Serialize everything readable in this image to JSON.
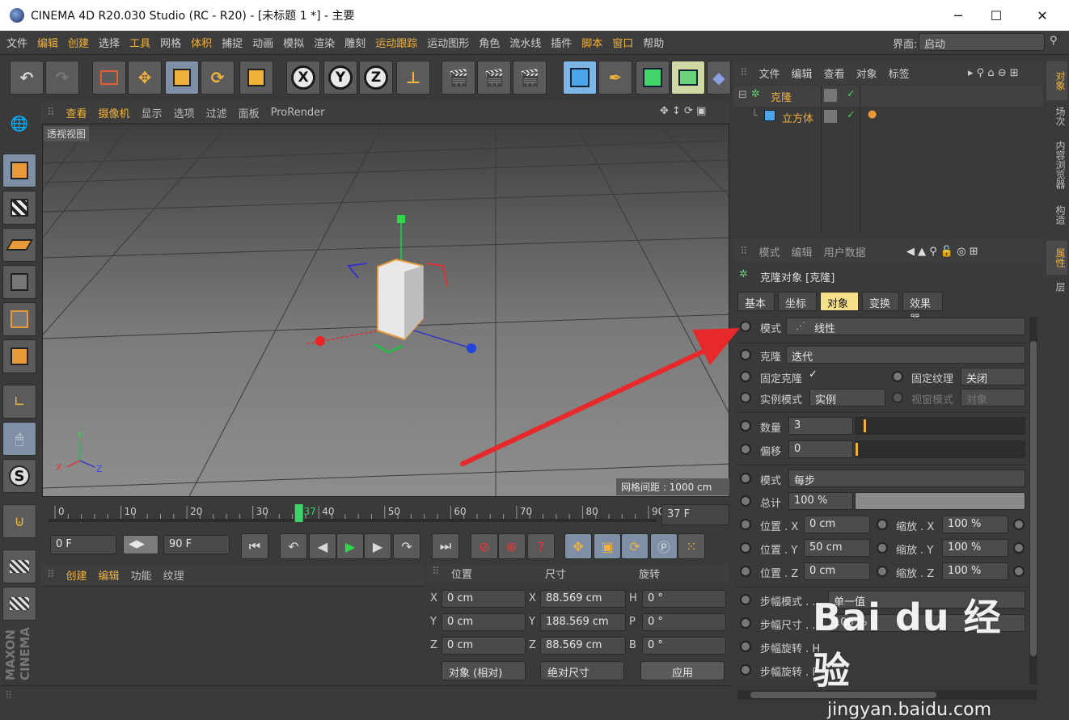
{
  "window": {
    "title": "CINEMA 4D R20.030 Studio (RC - R20) - [未标题 1 *] - 主要",
    "controls": {
      "minimize": "─",
      "maximize": "☐",
      "close": "✕"
    }
  },
  "menubar": {
    "items": [
      "文件",
      "编辑",
      "创建",
      "选择",
      "工具",
      "网格",
      "体积",
      "捕捉",
      "动画",
      "模拟",
      "渲染",
      "雕刻",
      "运动跟踪",
      "运动图形",
      "角色",
      "流水线",
      "插件",
      "脚本",
      "窗口",
      "帮助"
    ],
    "highlighted": [
      "编辑",
      "创建",
      "工具",
      "体积",
      "运动跟踪",
      "脚本",
      "窗口"
    ],
    "layout_label": "界面:",
    "layout_value": "启动"
  },
  "toolbar": {
    "axis_x": "X",
    "axis_y": "Y",
    "axis_z": "Z"
  },
  "viewport": {
    "menu": [
      "查看",
      "摄像机",
      "显示",
      "选项",
      "过滤",
      "面板",
      "ProRender"
    ],
    "highlighted": [
      "查看",
      "摄像机"
    ],
    "label": "透视视图",
    "grid_spacing": "网格间距 : 1000 cm",
    "axis_labels": {
      "x": "X",
      "y": "Y",
      "z": "Z"
    }
  },
  "timeline": {
    "ticks": [
      "0",
      "10",
      "20",
      "30",
      "40",
      "50",
      "60",
      "70",
      "80",
      "90"
    ],
    "current_frame_marker": "37",
    "frame_field": "37 F",
    "start_field": "0 F",
    "end_field": "90 F",
    "current_fraction": 0.411
  },
  "materials": {
    "menu": [
      "创建",
      "编辑",
      "功能",
      "纹理"
    ]
  },
  "coordinates": {
    "headers": [
      "位置",
      "尺寸",
      "旋转"
    ],
    "rows": [
      {
        "pos_label": "X",
        "pos": "0 cm",
        "size_label": "X",
        "size": "88.569 cm",
        "rot_label": "H",
        "rot": "0 °"
      },
      {
        "pos_label": "Y",
        "pos": "0 cm",
        "size_label": "Y",
        "size": "188.569 cm",
        "rot_label": "P",
        "rot": "0 °"
      },
      {
        "pos_label": "Z",
        "pos": "0 cm",
        "size_label": "Z",
        "size": "88.569 cm",
        "rot_label": "B",
        "rot": "0 °"
      }
    ],
    "mode_dropdown": "对象 (相对)",
    "size_dropdown": "绝对尺寸",
    "apply_button": "应用"
  },
  "object_manager": {
    "menu": [
      "文件",
      "编辑",
      "查看",
      "对象",
      "标签"
    ],
    "objects": [
      {
        "name": "克隆",
        "indent": 0
      },
      {
        "name": "立方体",
        "indent": 1
      }
    ],
    "check": "✓"
  },
  "attributes": {
    "menu": [
      "模式",
      "编辑",
      "用户数据"
    ],
    "title": "克隆对象 [克隆]",
    "tabs": [
      "基本",
      "坐标",
      "对象",
      "变换",
      "效果器"
    ],
    "selected_tab": "对象",
    "mode_label": "模式",
    "mode_value": "线性",
    "clones_label": "克隆",
    "clones_value": "迭代",
    "fix_clone_label": "固定克隆",
    "fix_clone_check": "✓",
    "fix_texture_label": "固定纹理",
    "fix_texture_value": "关闭",
    "instance_mode_label": "实例模式",
    "instance_mode_value": "实例",
    "viewport_mode_label": "视窗模式",
    "viewport_mode_value": "对象",
    "count_label": "数量",
    "count_value": "3",
    "offset_label": "偏移",
    "offset_value": "0",
    "mode2_label": "模式",
    "mode2_value": "每步",
    "amount_label": "总计",
    "amount_value": "100 %",
    "pos_x_label": "位置 . X",
    "pos_x_value": "0 cm",
    "pos_y_label": "位置 . Y",
    "pos_y_value": "50 cm",
    "pos_z_label": "位置 . Z",
    "pos_z_value": "0 cm",
    "scale_x_label": "缩放 . X",
    "scale_x_value": "100 %",
    "scale_y_label": "缩放 . Y",
    "scale_y_value": "100 %",
    "scale_z_label": "缩放 . Z",
    "scale_z_value": "100 %",
    "step_mode_label": "步幅模式 . . .",
    "step_mode_value": "单一值",
    "step_size_label": "步幅尺寸 . . .",
    "step_size_value": "100 %",
    "step_rot_h_label": "步幅旋转 . H",
    "step_rot_p_label": "步幅旋转 . P"
  },
  "side_tabs": [
    "对象",
    "场次",
    "内容浏览器",
    "构造",
    "属性",
    "层"
  ],
  "side_tabs_selected": [
    "对象",
    "属性"
  ],
  "watermark": {
    "logo": "Bai du 经验",
    "url": "jingyan.baidu.com"
  },
  "colors": {
    "accent": "#f0b23a",
    "arrow": "#e8292b",
    "selected_tab": "#f7e08a"
  }
}
